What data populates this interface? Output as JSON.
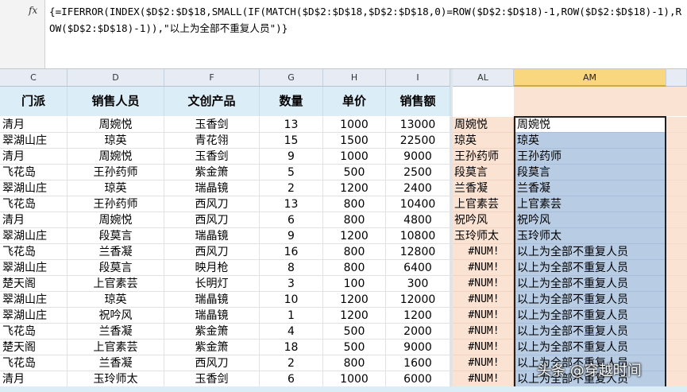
{
  "formula_bar": {
    "fx_label": "fx",
    "formula": "{=IFERROR(INDEX($D$2:$D$18,SMALL(IF(MATCH($D$2:$D$18,$D$2:$D$18,0)=ROW($D$2:$D$18)-1,ROW($D$2:$D$18)-1),ROW($D$2:$D$18)-1)),\"以上为全部不重复人员\")}"
  },
  "columns": [
    "C",
    "D",
    "F",
    "G",
    "H",
    "I",
    "AL",
    "AM"
  ],
  "selected_column": "AM",
  "headers": {
    "C": "门派",
    "D": "销售人员",
    "F": "文创产品",
    "G": "数量",
    "H": "单价",
    "I": "销售额"
  },
  "rows": [
    {
      "C": "清月",
      "D": "周婉悦",
      "F": "玉香剑",
      "G": "13",
      "H": "1000",
      "I": "13000",
      "AL": "周婉悦",
      "AM": "周婉悦"
    },
    {
      "C": "翠湖山庄",
      "D": "琼英",
      "F": "青花翎",
      "G": "15",
      "H": "1500",
      "I": "22500",
      "AL": "琼英",
      "AM": "琼英"
    },
    {
      "C": "清月",
      "D": "周婉悦",
      "F": "玉香剑",
      "G": "9",
      "H": "1000",
      "I": "9000",
      "AL": "王孙药师",
      "AM": "王孙药师"
    },
    {
      "C": "飞花岛",
      "D": "王孙药师",
      "F": "紫金箫",
      "G": "5",
      "H": "500",
      "I": "2500",
      "AL": "段莫言",
      "AM": "段莫言"
    },
    {
      "C": "翠湖山庄",
      "D": "琼英",
      "F": "瑞晶镜",
      "G": "2",
      "H": "1200",
      "I": "2400",
      "AL": "兰香凝",
      "AM": "兰香凝"
    },
    {
      "C": "飞花岛",
      "D": "王孙药师",
      "F": "西风刀",
      "G": "13",
      "H": "800",
      "I": "10400",
      "AL": "上官素芸",
      "AM": "上官素芸"
    },
    {
      "C": "清月",
      "D": "周婉悦",
      "F": "西风刀",
      "G": "6",
      "H": "800",
      "I": "4800",
      "AL": "祝吟风",
      "AM": "祝吟风"
    },
    {
      "C": "翠湖山庄",
      "D": "段莫言",
      "F": "瑞晶镜",
      "G": "9",
      "H": "1200",
      "I": "10800",
      "AL": "玉玲师太",
      "AM": "玉玲师太"
    },
    {
      "C": "飞花岛",
      "D": "兰香凝",
      "F": "西风刀",
      "G": "16",
      "H": "800",
      "I": "12800",
      "AL": "#NUM!",
      "AM": "以上为全部不重复人员"
    },
    {
      "C": "翠湖山庄",
      "D": "段莫言",
      "F": "映月枪",
      "G": "8",
      "H": "800",
      "I": "6400",
      "AL": "#NUM!",
      "AM": "以上为全部不重复人员"
    },
    {
      "C": "楚天阁",
      "D": "上官素芸",
      "F": "长明灯",
      "G": "3",
      "H": "100",
      "I": "300",
      "AL": "#NUM!",
      "AM": "以上为全部不重复人员"
    },
    {
      "C": "翠湖山庄",
      "D": "琼英",
      "F": "瑞晶镜",
      "G": "10",
      "H": "1200",
      "I": "12000",
      "AL": "#NUM!",
      "AM": "以上为全部不重复人员"
    },
    {
      "C": "翠湖山庄",
      "D": "祝吟风",
      "F": "瑞晶镜",
      "G": "1",
      "H": "1200",
      "I": "1200",
      "AL": "#NUM!",
      "AM": "以上为全部不重复人员"
    },
    {
      "C": "飞花岛",
      "D": "兰香凝",
      "F": "紫金箫",
      "G": "4",
      "H": "500",
      "I": "2000",
      "AL": "#NUM!",
      "AM": "以上为全部不重复人员"
    },
    {
      "C": "楚天阁",
      "D": "上官素芸",
      "F": "紫金箫",
      "G": "18",
      "H": "500",
      "I": "9000",
      "AL": "#NUM!",
      "AM": "以上为全部不重复人员"
    },
    {
      "C": "飞花岛",
      "D": "兰香凝",
      "F": "西风刀",
      "G": "2",
      "H": "800",
      "I": "1600",
      "AL": "#NUM!",
      "AM": "以上为全部不重复人员"
    },
    {
      "C": "清月",
      "D": "玉玲师太",
      "F": "玉香剑",
      "G": "6",
      "H": "1000",
      "I": "6000",
      "AL": "#NUM!",
      "AM": "以上为全部不重复人员"
    }
  ],
  "watermark": "头条 @穿越时间",
  "colors": {
    "selected_fill": "#b8cce4",
    "al_fill": "#fbe3d4",
    "header_fill": "#dbeef7",
    "col_header_selected": "#f9d77e"
  }
}
